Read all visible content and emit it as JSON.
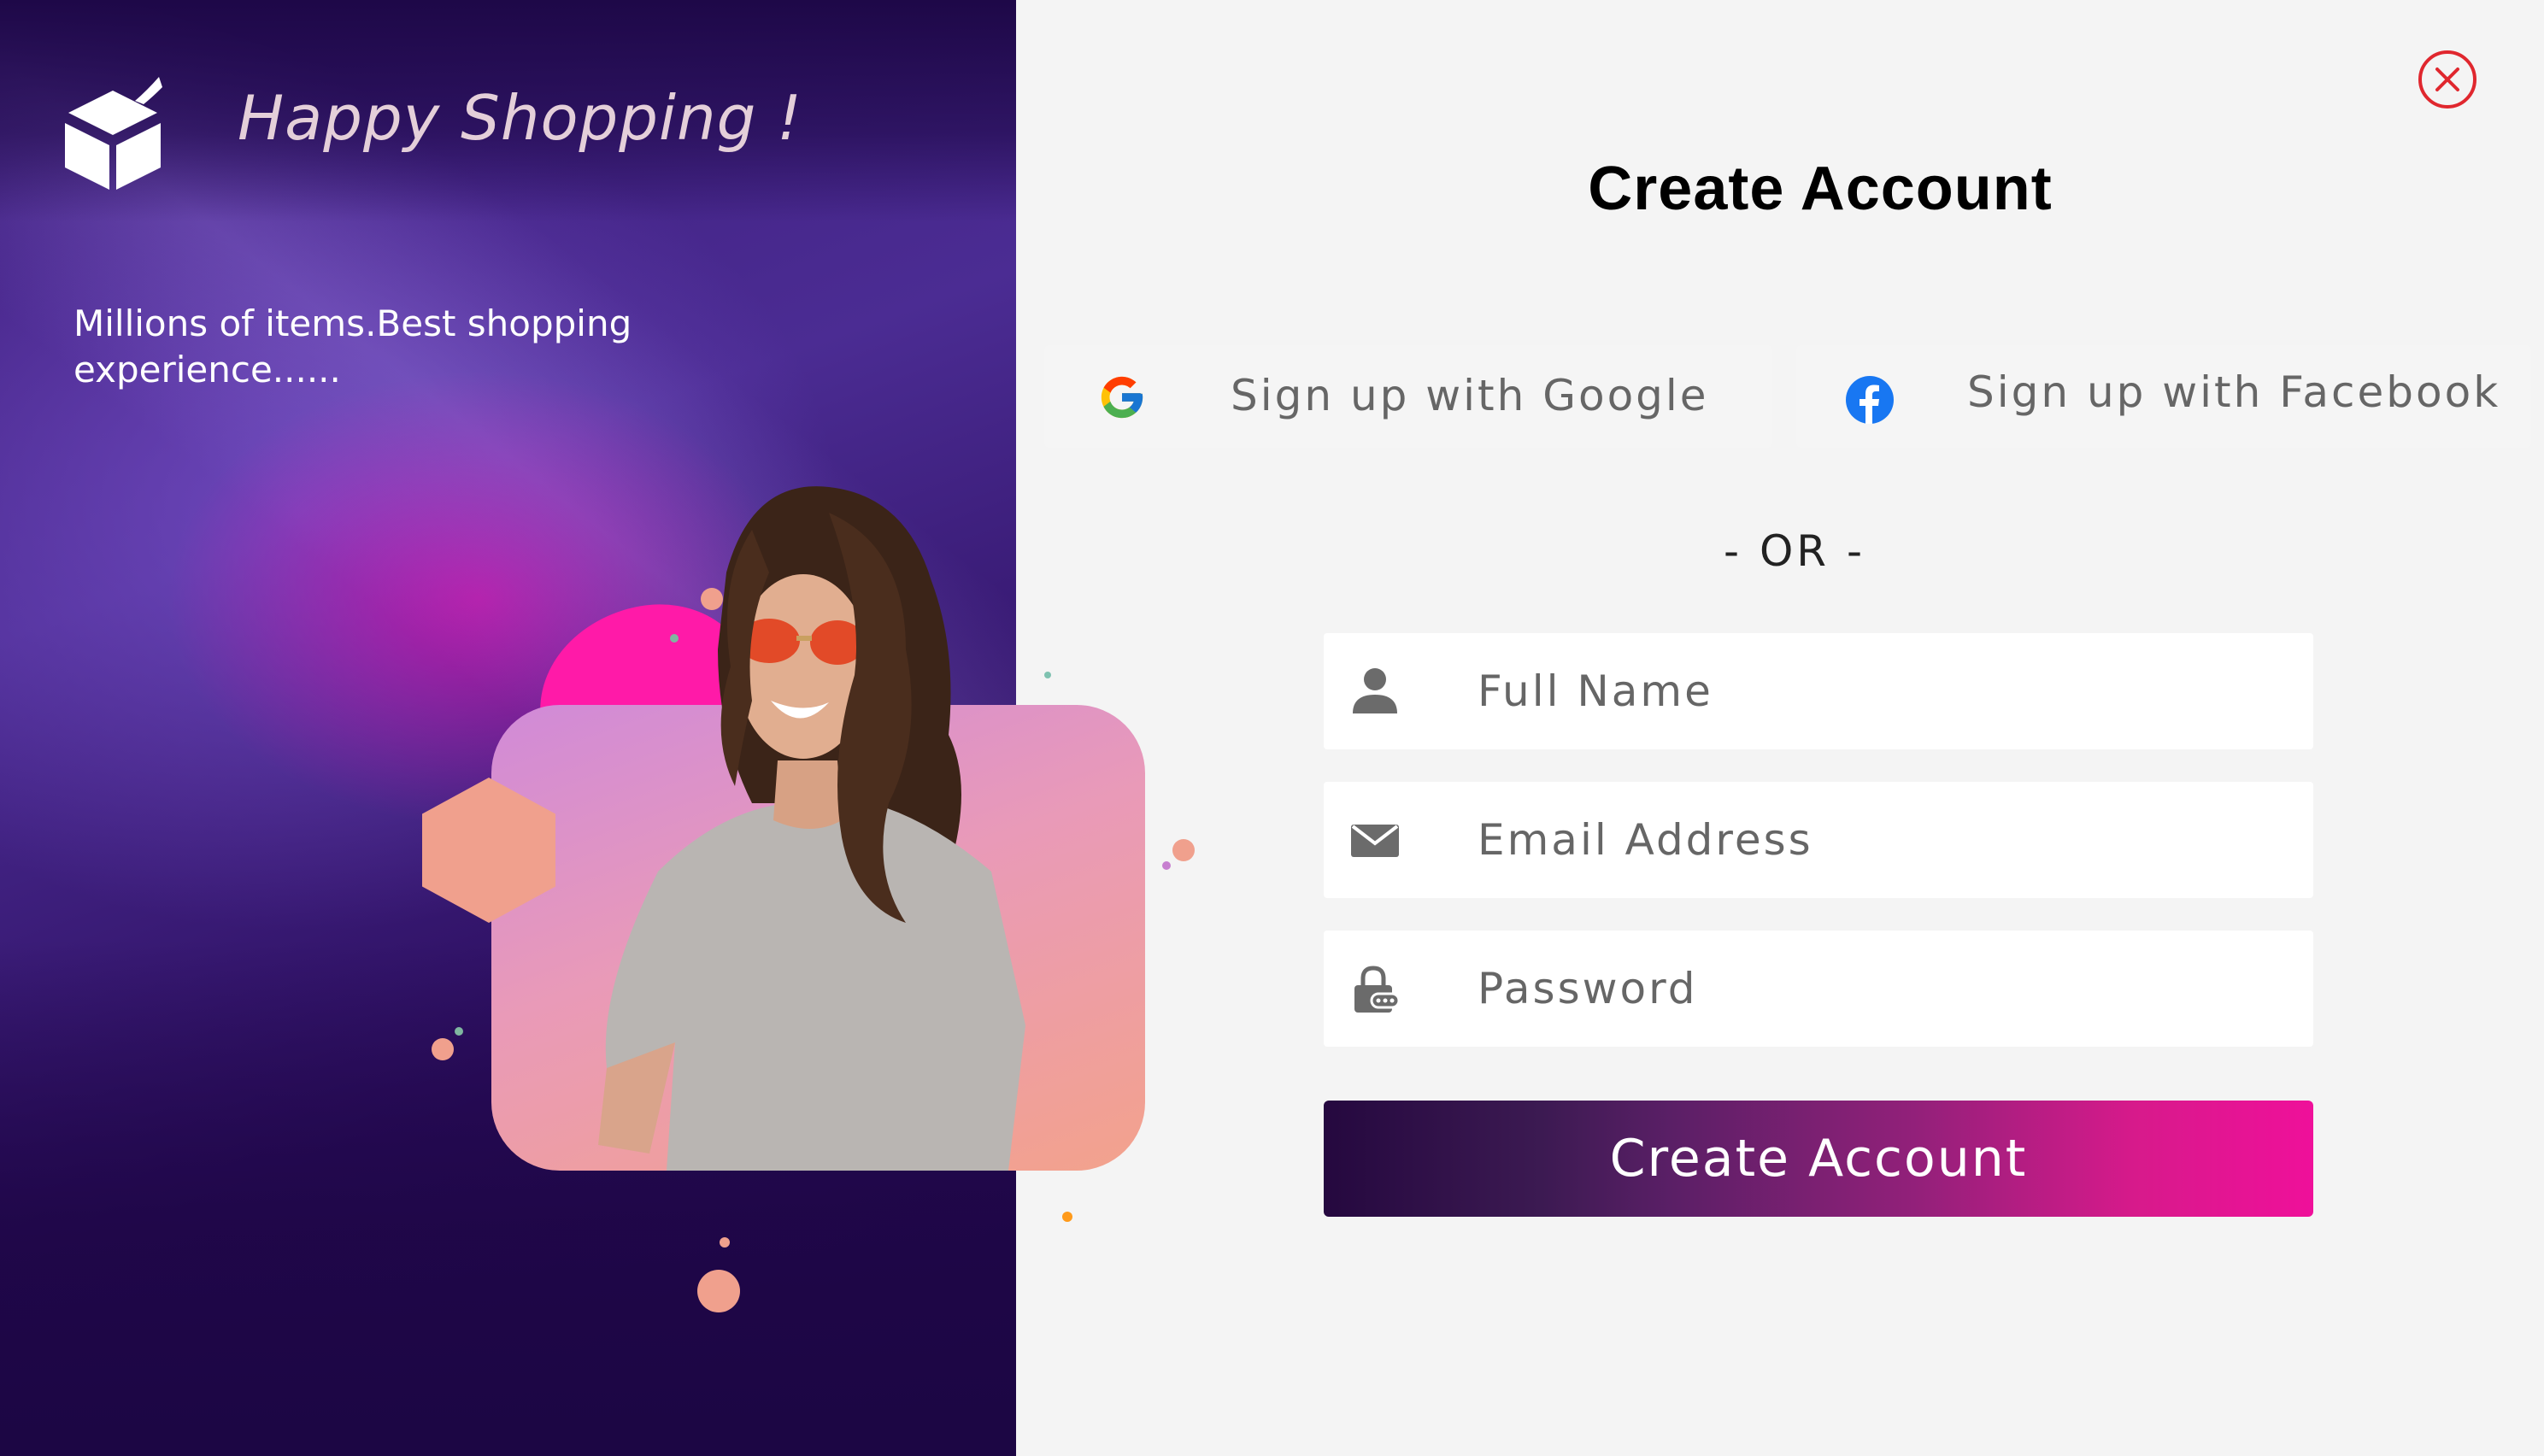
{
  "brand": {
    "title": "Happy Shopping !",
    "tagline": "Millions of items.Best shopping experience......",
    "logo_icon": "box-icon"
  },
  "form": {
    "title": "Create Account",
    "close_icon": "close-icon",
    "google_label": "Sign up with Google",
    "facebook_label": "Sign up with Facebook",
    "or_text": "- OR -",
    "full_name_placeholder": "Full Name",
    "email_placeholder": "Email Address",
    "password_placeholder": "Password",
    "submit_label": "Create Account"
  },
  "colors": {
    "accent_pink": "#ef109a",
    "accent_dark": "#25083f",
    "close_red": "#e0272e",
    "panel_purple": "#4b2c93"
  }
}
